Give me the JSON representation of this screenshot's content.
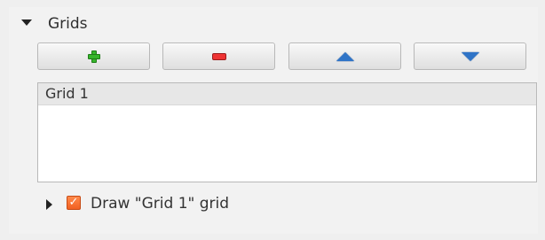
{
  "section": {
    "title": "Grids"
  },
  "toolbar": {
    "buttons": [
      {
        "icon": "plus-icon"
      },
      {
        "icon": "minus-icon"
      },
      {
        "icon": "up-arrow-icon"
      },
      {
        "icon": "down-arrow-icon"
      }
    ]
  },
  "list": {
    "items": [
      {
        "label": "Grid 1"
      }
    ]
  },
  "draw": {
    "label": "Draw \"Grid 1\" grid",
    "checked": true,
    "check_glyph": "✓"
  },
  "colors": {
    "background": "#efefef",
    "selection": "#e7e7e7",
    "checkbox_orange": "#f26022",
    "plus_green": "#36b52b",
    "minus_red": "#e33",
    "arrow_blue": "#2f74c7"
  }
}
